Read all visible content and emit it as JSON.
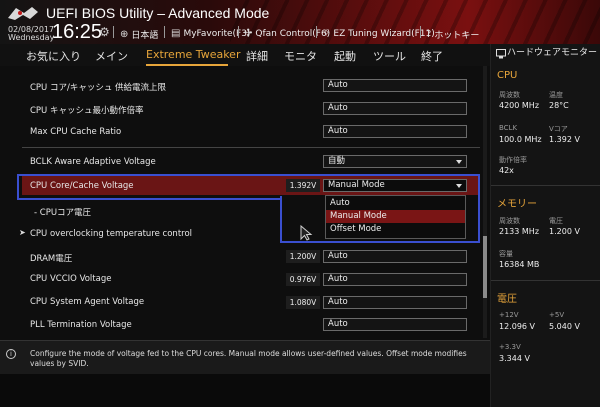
{
  "header": {
    "title": "UEFI BIOS Utility – Advanced Mode",
    "date": "02/08/2017",
    "day": "Wednesday",
    "time": "16:25",
    "items": [
      {
        "label": "日本語",
        "icon": "globe-icon"
      },
      {
        "label": "MyFavorite(F3)",
        "icon": "favorite-icon"
      },
      {
        "label": "Qfan Control(F6)",
        "icon": "fan-icon"
      },
      {
        "label": "EZ Tuning Wizard(F11)",
        "icon": "wand-icon"
      },
      {
        "label": "ホットキー",
        "icon": "question-icon"
      }
    ]
  },
  "menu": {
    "items": [
      "お気に入り",
      "メイン",
      "Extreme Tweaker",
      "詳細",
      "モニタ",
      "起動",
      "ツール",
      "終了"
    ],
    "active": "Extreme Tweaker"
  },
  "settings": {
    "rows": [
      {
        "label": "CPU コア/キャッシュ 供給電流上限",
        "field": "Auto"
      },
      {
        "label": "CPU キャッシュ最小動作倍率",
        "field": "Auto"
      },
      {
        "label": "Max CPU Cache Ratio",
        "field": "Auto"
      },
      {
        "label": "BCLK Aware Adaptive Voltage",
        "field": "自動"
      },
      {
        "label": "CPU Core/Cache Voltage",
        "value": "1.392V",
        "field": "Manual Mode"
      },
      {
        "label": "- CPUコア電圧"
      },
      {
        "label": "CPU overclocking temperature control"
      },
      {
        "label": "DRAM電圧",
        "value": "1.200V",
        "field": "Auto"
      },
      {
        "label": "CPU VCCIO Voltage",
        "value": "0.976V",
        "field": "Auto"
      },
      {
        "label": "CPU System Agent Voltage",
        "value": "1.080V",
        "field": "Auto"
      },
      {
        "label": "PLL Termination Voltage",
        "field": "Auto"
      }
    ],
    "dropdown_options": [
      "Auto",
      "Manual Mode",
      "Offset Mode"
    ],
    "dropdown_selected": "Manual Mode"
  },
  "help": {
    "text": "Configure the mode of voltage fed to the CPU cores. Manual mode allows user-defined values. Offset mode modifies values by SVID."
  },
  "hw_monitor": {
    "title": "ハードウェアモニター",
    "cpu": {
      "section": "CPU",
      "freq_label": "周波数",
      "freq": "4200 MHz",
      "temp_label": "温度",
      "temp": "28°C",
      "bclk_label": "BCLK",
      "bclk": "100.0 MHz",
      "vcore_label": "Vコア",
      "vcore": "1.392 V",
      "ratio_label": "動作倍率",
      "ratio": "42x"
    },
    "memory": {
      "section": "メモリー",
      "freq_label": "周波数",
      "freq": "2133 MHz",
      "volt_label": "電圧",
      "volt": "1.200 V",
      "cap_label": "容量",
      "cap": "16384 MB"
    },
    "voltage": {
      "section": "電圧",
      "v12_label": "+12V",
      "v12": "12.096 V",
      "v5_label": "+5V",
      "v5": "5.040 V",
      "v33_label": "+3.3V",
      "v33": "3.344 V"
    }
  },
  "colors": {
    "accent": "#e7a53a",
    "highlight_row": "#6a1515",
    "selection_outline": "#3a4fd0"
  }
}
